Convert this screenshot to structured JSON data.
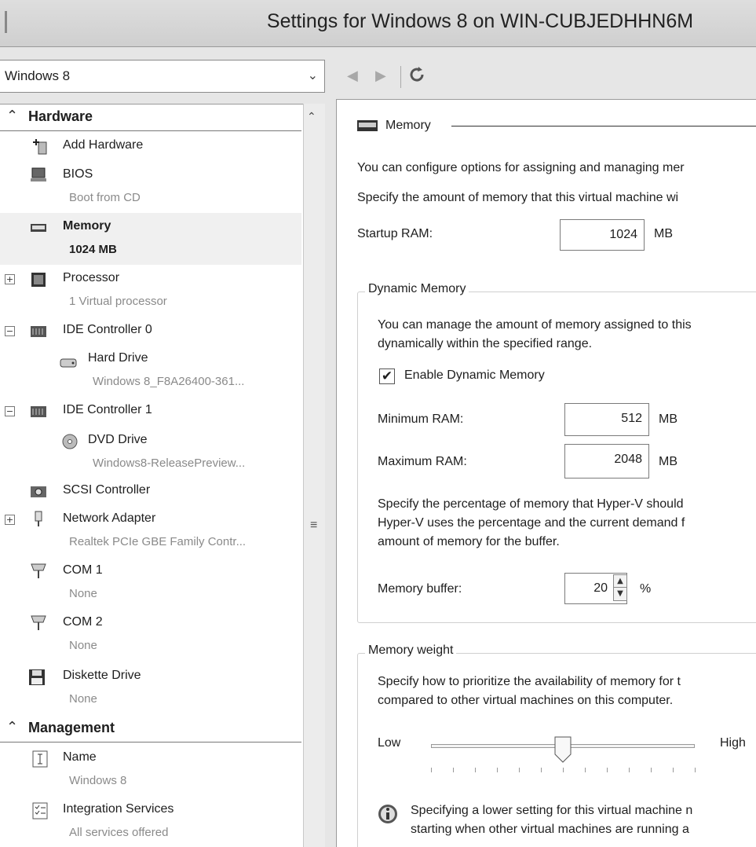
{
  "window": {
    "title": "Settings for Windows 8 on WIN-CUBJEDHHN6M"
  },
  "vm_selector": {
    "value": "Windows 8"
  },
  "toolbar": {
    "back_icon": "back-arrow-icon",
    "forward_icon": "forward-arrow-icon",
    "refresh_icon": "refresh-icon"
  },
  "tree": {
    "hardware_section": "Hardware",
    "management_section": "Management",
    "items": {
      "add_hardware": {
        "label": "Add Hardware"
      },
      "bios": {
        "label": "BIOS",
        "sub": "Boot from CD"
      },
      "memory": {
        "label": "Memory",
        "sub": "1024 MB"
      },
      "processor": {
        "label": "Processor",
        "sub": "1 Virtual processor"
      },
      "ide0": {
        "label": "IDE Controller 0"
      },
      "hard_drive": {
        "label": "Hard Drive",
        "sub": "Windows 8_F8A26400-361..."
      },
      "ide1": {
        "label": "IDE Controller 1"
      },
      "dvd_drive": {
        "label": "DVD Drive",
        "sub": "Windows8-ReleasePreview..."
      },
      "scsi": {
        "label": "SCSI Controller"
      },
      "network": {
        "label": "Network Adapter",
        "sub": "Realtek PCIe GBE Family Contr..."
      },
      "com1": {
        "label": "COM 1",
        "sub": "None"
      },
      "com2": {
        "label": "COM 2",
        "sub": "None"
      },
      "diskette": {
        "label": "Diskette Drive",
        "sub": "None"
      },
      "name": {
        "label": "Name",
        "sub": "Windows 8"
      },
      "integration": {
        "label": "Integration Services",
        "sub": "All services offered"
      }
    },
    "expander_plus": "+",
    "expander_minus": "−"
  },
  "memory_panel": {
    "header": "Memory",
    "intro1": "You can configure options for assigning and managing mer",
    "intro2": "Specify the amount of memory that this virtual machine wi",
    "startup_label": "Startup RAM:",
    "startup_value": "1024",
    "unit_mb": "MB",
    "dynamic": {
      "title": "Dynamic Memory",
      "desc1": "You can manage the amount of memory assigned to this",
      "desc2": "dynamically within the specified range.",
      "enable_label": "Enable Dynamic Memory",
      "enable_checked": "✔",
      "min_label": "Minimum RAM:",
      "min_value": "512",
      "max_label": "Maximum RAM:",
      "max_value": "2048",
      "buffer_desc1": "Specify the percentage of memory that Hyper-V should",
      "buffer_desc2": "Hyper-V uses the percentage and the current demand f",
      "buffer_desc3": "amount of memory for the buffer.",
      "buffer_label": "Memory buffer:",
      "buffer_value": "20",
      "buffer_unit": "%"
    },
    "weight": {
      "title": "Memory weight",
      "desc1": "Specify how to prioritize the availability of memory for t",
      "desc2": "compared to other virtual machines on this computer.",
      "low": "Low",
      "high": "High",
      "slider_position": 0.5,
      "note1": "Specifying a lower setting for this virtual machine n",
      "note2": "starting when other virtual machines are running a"
    }
  }
}
